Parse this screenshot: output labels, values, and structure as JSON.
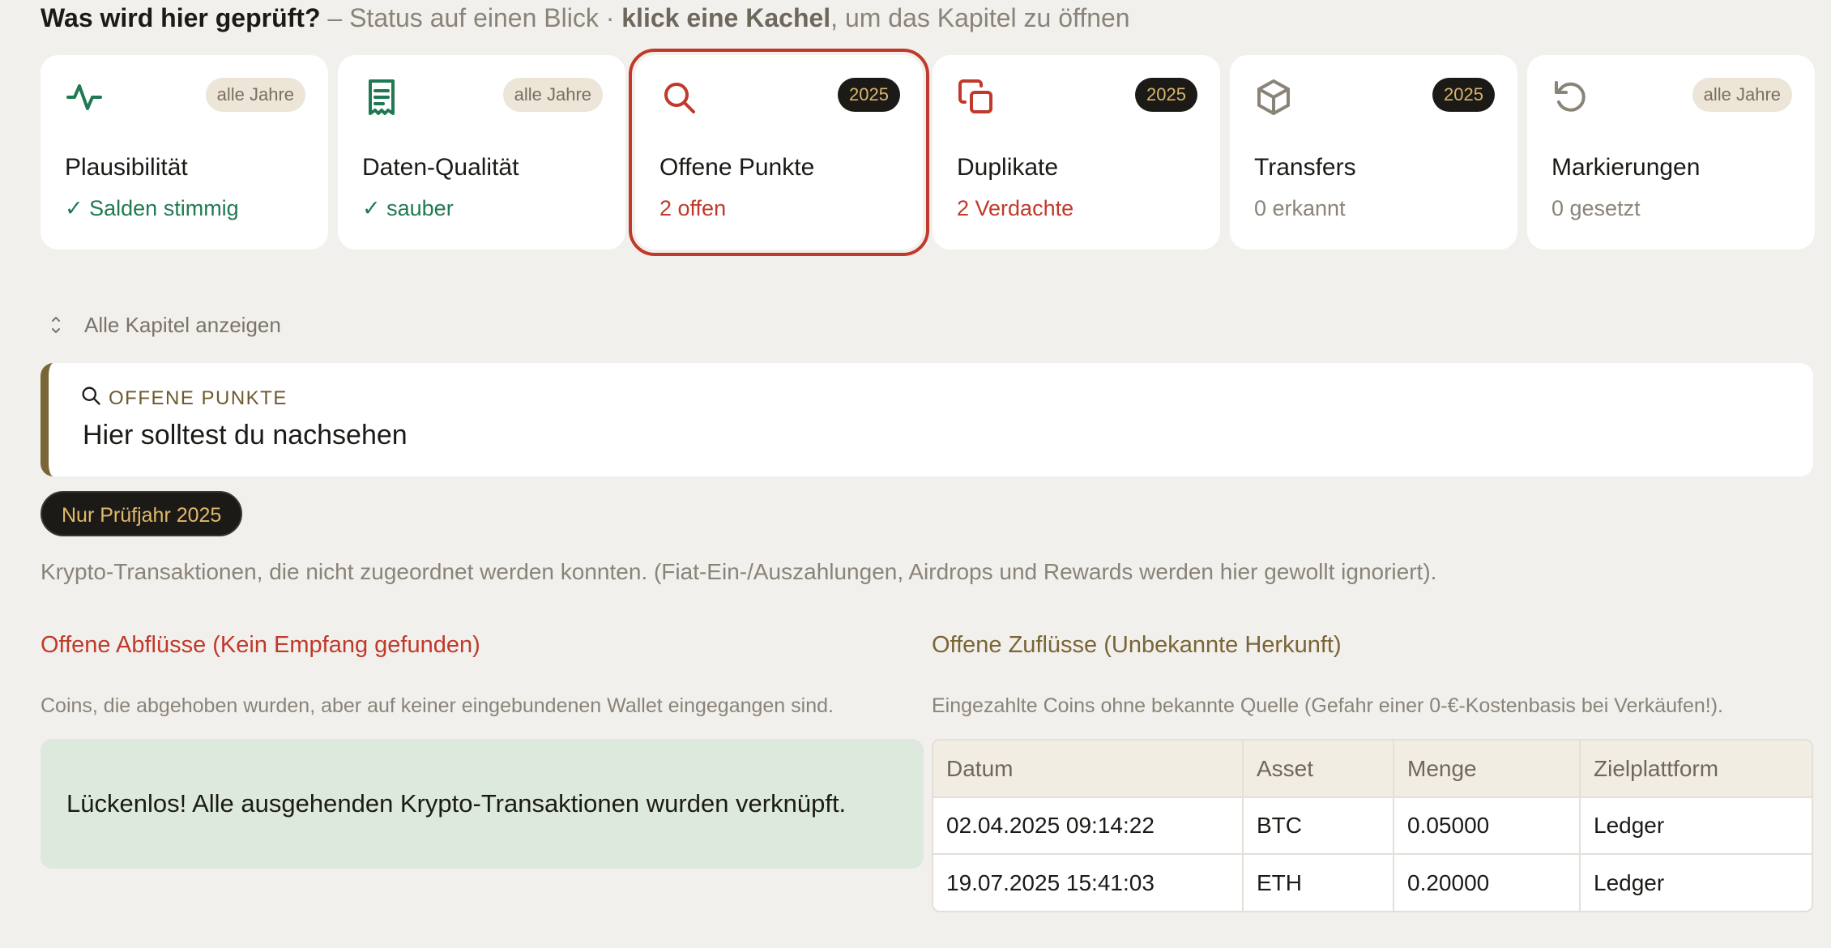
{
  "intro": {
    "question": "Was wird hier geprüft?",
    "part1": " – Status auf einen Blick · ",
    "bold": "klick eine Kachel",
    "part2": ", um das Kapitel zu öffnen"
  },
  "tiles": [
    {
      "icon": "pulse-icon",
      "badge": "alle Jahre",
      "title": "Plausibilität",
      "status": "✓ Salden stimmig",
      "status_kind": "ok"
    },
    {
      "icon": "receipt-icon",
      "badge": "alle Jahre",
      "title": "Daten-Qualität",
      "status": "✓ sauber",
      "status_kind": "ok"
    },
    {
      "icon": "search-icon",
      "badge": "2025",
      "title": "Offene Punkte",
      "status": "2 offen",
      "status_kind": "warn",
      "active": true
    },
    {
      "icon": "copy-icon",
      "badge": "2025",
      "title": "Duplikate",
      "status": "2 Verdachte",
      "status_kind": "warn"
    },
    {
      "icon": "cube-icon",
      "badge": "2025",
      "title": "Transfers",
      "status": "0 erkannt",
      "status_kind": "neutral"
    },
    {
      "icon": "rotate-ccw-icon",
      "badge": "alle Jahre",
      "title": "Markierungen",
      "status": "0 gesetzt",
      "status_kind": "neutral"
    }
  ],
  "show_all": "Alle Kapitel anzeigen",
  "section": {
    "eyebrow": "OFFENE PUNKTE",
    "heading": "Hier solltest du nachsehen",
    "year_pill": "Nur Prüfjahr 2025",
    "description": "Krypto-Transaktionen, die nicht zugeordnet werden konnten. (Fiat-Ein-/Auszahlungen, Airdrops und Rewards werden hier gewollt ignoriert)."
  },
  "outflows": {
    "title": "Offene Abflüsse (Kein Empfang gefunden)",
    "subtitle": "Coins, die abgehoben wurden, aber auf keiner eingebundenen Wallet eingegangen sind.",
    "success": "Lückenlos! Alle ausgehenden Krypto-Transaktionen wurden verknüpft."
  },
  "inflows": {
    "title": "Offene Zuflüsse (Unbekannte Herkunft)",
    "subtitle": "Eingezahlte Coins ohne bekannte Quelle (Gefahr einer 0-€-Kostenbasis bei Verkäufen!).",
    "columns": [
      "Datum",
      "Asset",
      "Menge",
      "Zielplattform"
    ],
    "rows": [
      [
        "02.04.2025 09:14:22",
        "BTC",
        "0.05000",
        "Ledger"
      ],
      [
        "19.07.2025 15:41:03",
        "ETH",
        "0.20000",
        "Ledger"
      ]
    ]
  },
  "colors": {
    "accent_red": "#c0392b",
    "ok_green": "#1f7a52",
    "gold": "#7a6536",
    "dark": "#1c1a17"
  }
}
